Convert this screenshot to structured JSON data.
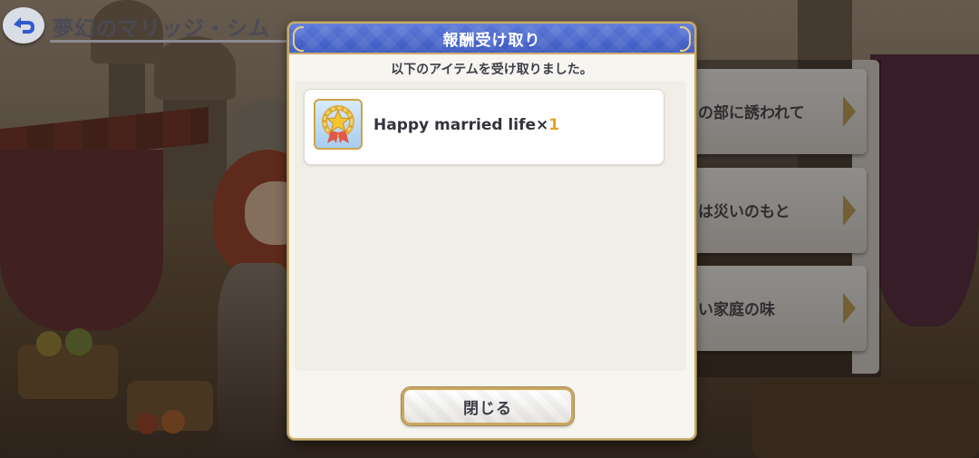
{
  "header": {
    "title": "夢幻のマリッジ・シム　エ"
  },
  "menu": {
    "items": [
      {
        "label": "の部に誘われて"
      },
      {
        "label": "は災いのもと"
      },
      {
        "label": "い家庭の味"
      }
    ]
  },
  "dialog": {
    "title": "報酬受け取り",
    "message": "以下のアイテムを受け取りました。",
    "reward": {
      "name": "Happy married life",
      "times": "×",
      "quantity": "1",
      "icon": "star-wreath-medal-icon"
    },
    "close_label": "閉じる"
  },
  "colors": {
    "header_blue": "#4a66cc",
    "gold_border": "#c9ad6c",
    "quantity_orange": "#e7a024"
  }
}
